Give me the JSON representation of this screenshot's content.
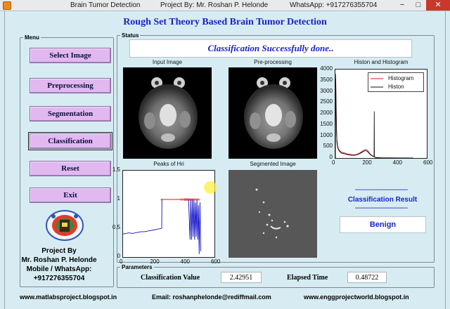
{
  "window": {
    "app_name": "Brain Tumor Detection",
    "author": "Project By: Mr. Roshan P. Helonde",
    "whatsapp": "WhatsApp: +917276355704",
    "minimize": "−",
    "maximize": "□",
    "close": "✕"
  },
  "app_title": "Rough Set Theory Based Brain Tumor Detection",
  "menu": {
    "legend": "Menu",
    "buttons": [
      "Select Image",
      "Preprocessing",
      "Segmentation",
      "Classification",
      "Reset",
      "Exit"
    ]
  },
  "status": {
    "legend": "Status",
    "message": "Classification Successfully done.."
  },
  "plots": {
    "input_title": "Input Image",
    "preprocessing_title": "Pre-processing",
    "histogram_title": "Histon and Histogram",
    "peaks_title": "Peaks of Hri",
    "segmented_title": "Segmented Image"
  },
  "result": {
    "dashes": "--------------------------------",
    "title": "Classification Result",
    "value": "Benign"
  },
  "parameters": {
    "legend": "Parameters",
    "classification_label": "Classification Value",
    "classification_value": "2.42951",
    "elapsed_label": "Elapsed Time",
    "elapsed_value": "0.48722"
  },
  "credit": {
    "line1": "Project By",
    "line2": "Mr. Roshan P. Helonde",
    "line3": "Mobile / WhatsApp:",
    "line4": "+917276355704"
  },
  "footer": {
    "blog": "www.matlabsproject.blogspot.in",
    "email": "Email: roshanphelonde@rediffmail.com",
    "site": "www.enggprojectworld.blogspot.in"
  },
  "chart_data": [
    {
      "type": "line",
      "title": "Histon and Histogram",
      "xlim": [
        0,
        600
      ],
      "ylim": [
        0,
        4000
      ],
      "x_ticks": [
        0,
        200,
        400,
        600
      ],
      "y_ticks": [
        0,
        500,
        1000,
        1500,
        2000,
        2500,
        3000,
        3500,
        4000
      ],
      "legend_position": "top-right",
      "series": [
        {
          "name": "Histogram",
          "color": "#d01818",
          "x": [
            0,
            2,
            4,
            6,
            8,
            10,
            15,
            20,
            30,
            40,
            60,
            80,
            100,
            120,
            140,
            160,
            180,
            190,
            200,
            210,
            220,
            230,
            240,
            250,
            255,
            265,
            300,
            400,
            500,
            510
          ],
          "y": [
            0,
            3800,
            2800,
            1900,
            1200,
            800,
            550,
            420,
            320,
            260,
            230,
            180,
            160,
            140,
            160,
            230,
            320,
            360,
            380,
            350,
            250,
            170,
            120,
            80,
            60,
            30,
            10,
            5,
            3,
            0
          ]
        },
        {
          "name": "Histon",
          "color": "#111111",
          "x": [
            0,
            2,
            4,
            6,
            8,
            10,
            15,
            20,
            30,
            40,
            60,
            80,
            100,
            120,
            140,
            160,
            180,
            190,
            200,
            210,
            220,
            230,
            240,
            250,
            254,
            255,
            256,
            258,
            265,
            300,
            400,
            500,
            510
          ],
          "y": [
            0,
            3600,
            2500,
            1700,
            1100,
            700,
            480,
            380,
            280,
            220,
            190,
            150,
            130,
            120,
            140,
            200,
            280,
            320,
            330,
            300,
            220,
            150,
            100,
            70,
            60,
            2100,
            60,
            40,
            20,
            8,
            4,
            2,
            0
          ]
        }
      ]
    },
    {
      "type": "line",
      "title": "Peaks of Hri",
      "xlim": [
        0,
        600
      ],
      "ylim": [
        0,
        1.5
      ],
      "x_ticks": [
        0,
        200,
        400,
        600
      ],
      "y_ticks": [
        0,
        0.5,
        1,
        1.5
      ],
      "series": [
        {
          "name": "",
          "color": "#1010c8",
          "x": [
            0,
            20,
            40,
            60,
            80,
            100,
            120,
            140,
            160,
            180,
            200,
            220,
            240,
            254,
            255,
            300,
            350,
            400,
            430,
            440,
            445,
            450,
            455,
            460,
            465,
            470,
            475,
            480,
            485,
            490,
            495,
            500,
            505,
            510
          ],
          "y": [
            0.4,
            0.41,
            0.42,
            0.41,
            0.42,
            0.43,
            0.44,
            0.44,
            0.45,
            0.46,
            0.47,
            0.48,
            0.49,
            0.5,
            1.0,
            1.0,
            1.0,
            1.0,
            1.0,
            0.3,
            1.0,
            0.3,
            1.0,
            0.35,
            1.0,
            0.3,
            0.95,
            0.35,
            1.0,
            0.3,
            0.9,
            0.05,
            0.95,
            0.1
          ]
        },
        {
          "name": "",
          "color": "#e01010",
          "x": [
            255,
            380,
            390,
            400,
            405,
            410,
            415,
            420,
            425,
            430,
            435,
            440,
            445,
            450,
            455,
            460,
            470,
            480,
            490,
            500
          ],
          "y": [
            1,
            1,
            1,
            1,
            1,
            1,
            1,
            1,
            1,
            1,
            1,
            1,
            1,
            1,
            1,
            1,
            1,
            1,
            1,
            1
          ]
        }
      ]
    }
  ]
}
